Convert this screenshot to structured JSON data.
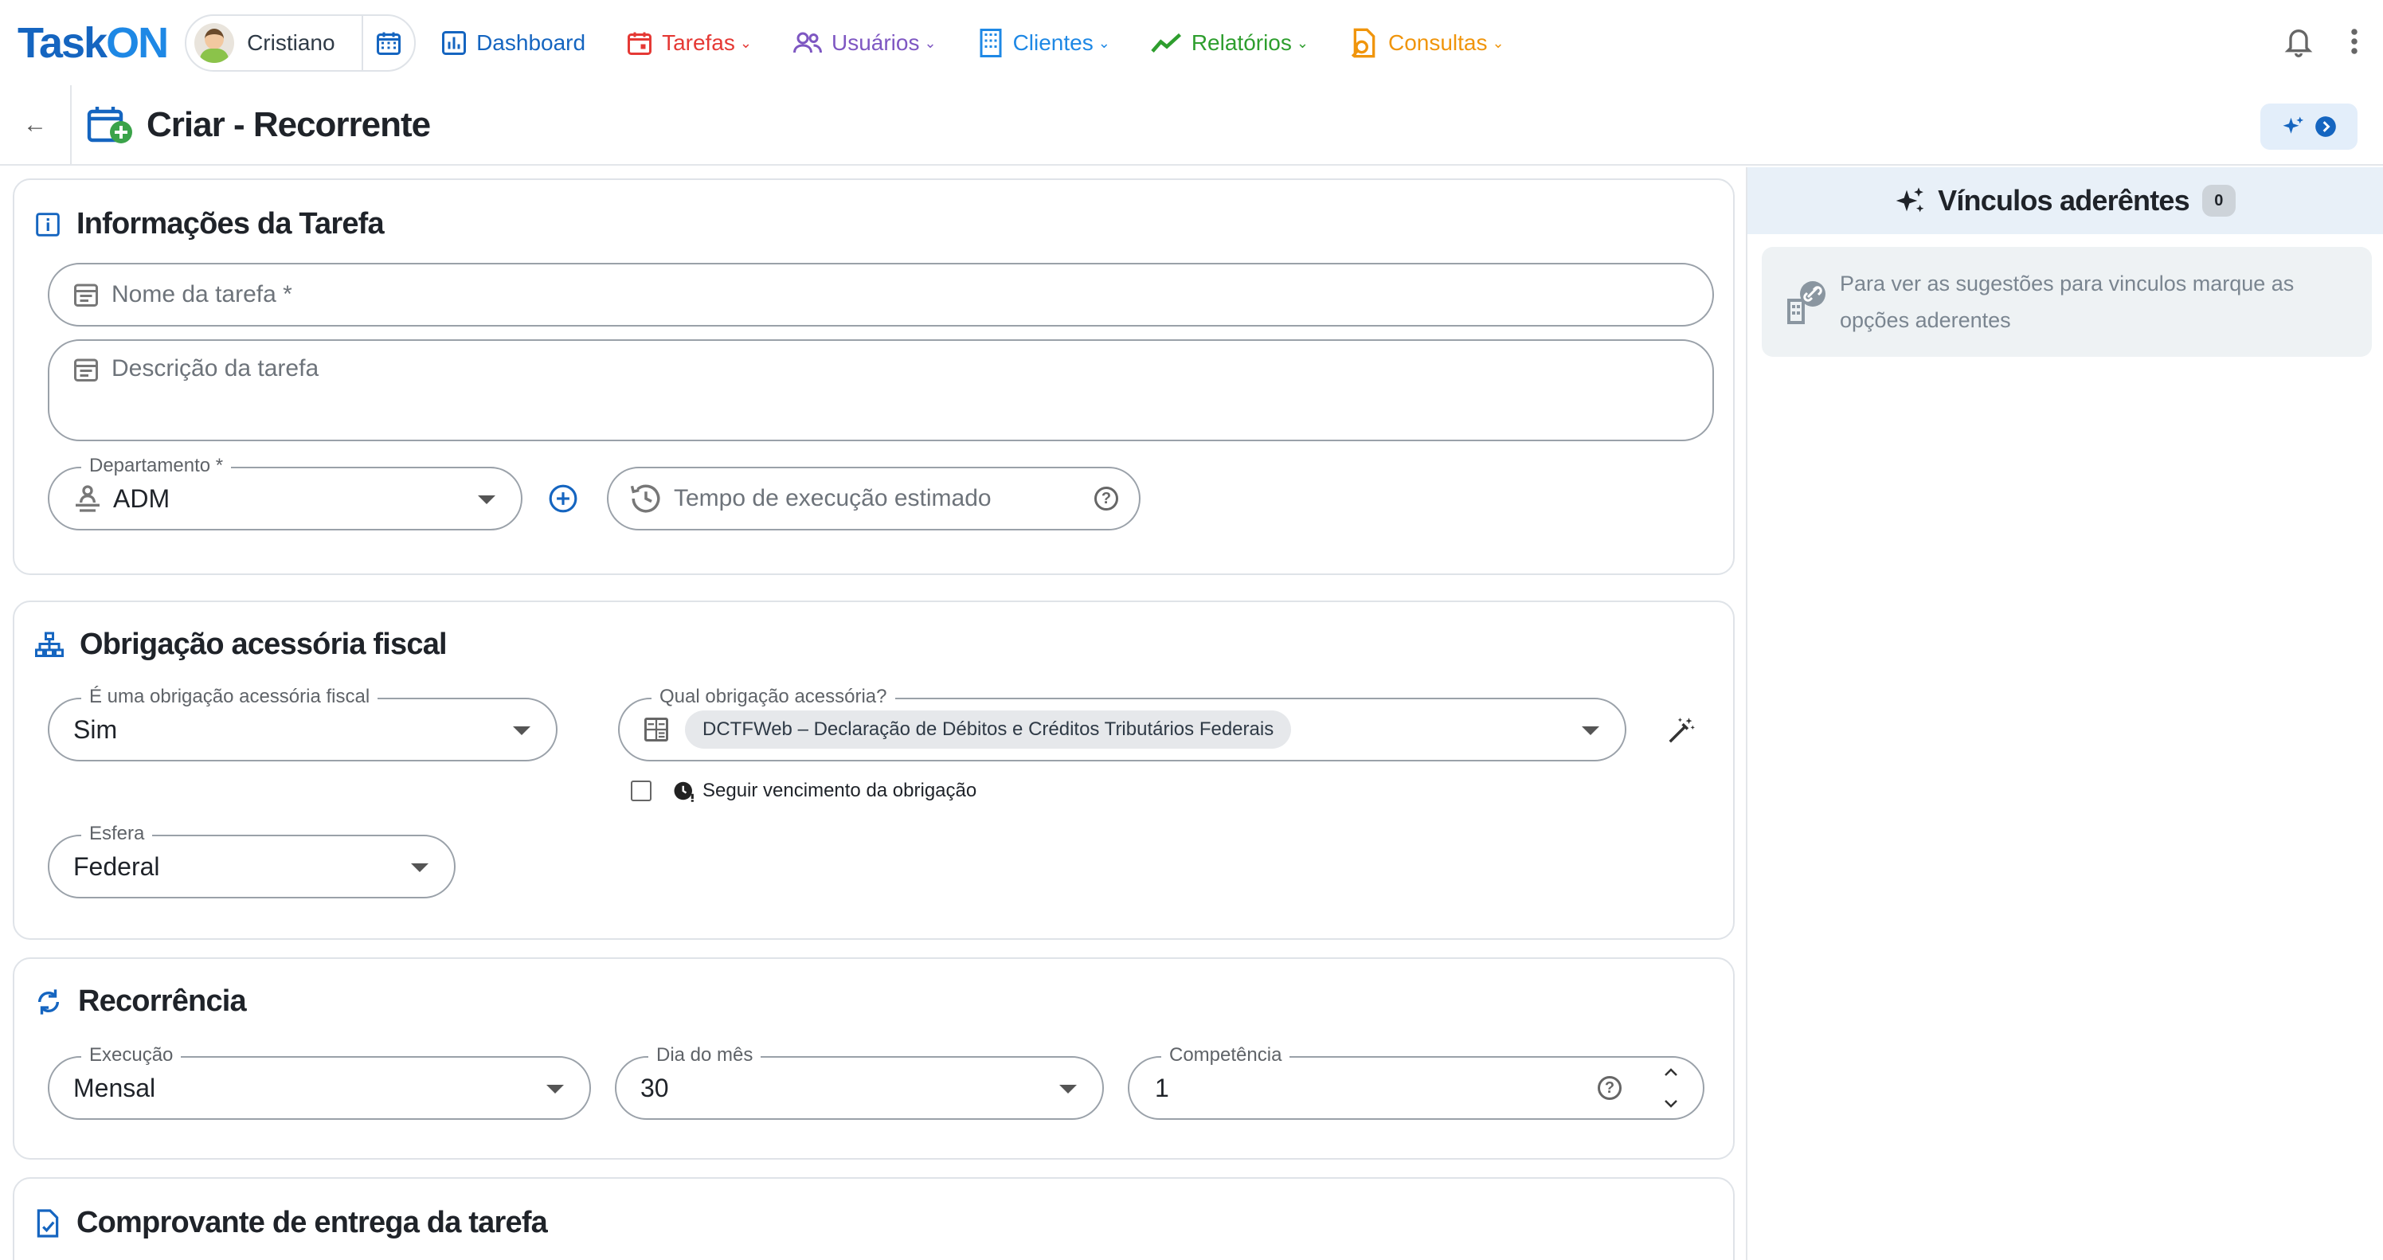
{
  "brand": {
    "logo_task": "Task",
    "logo_on": "ON"
  },
  "user": {
    "name": "Cristiano"
  },
  "nav": {
    "items": [
      {
        "label": "Dashboard",
        "color": "#1565c0",
        "has_menu": false
      },
      {
        "label": "Tarefas",
        "color": "#e53935",
        "has_menu": true
      },
      {
        "label": "Usuários",
        "color": "#7e57c2",
        "has_menu": true
      },
      {
        "label": "Clientes",
        "color": "#1e88e5",
        "has_menu": true
      },
      {
        "label": "Relatórios",
        "color": "#2e9e2e",
        "has_menu": true
      },
      {
        "label": "Consultas",
        "color": "#f0950c",
        "has_menu": true
      }
    ],
    "chevron": "⌄"
  },
  "title": {
    "back": "←",
    "text": "Criar - Recorrente"
  },
  "sections": {
    "info": {
      "title": "Informações da Tarefa",
      "task_name_placeholder": "Nome da tarefa *",
      "task_desc_placeholder": "Descrição da tarefa",
      "department": {
        "label": "Departamento *",
        "value": "ADM"
      },
      "exec_time_placeholder": "Tempo de execução estimado"
    },
    "fiscal": {
      "title": "Obrigação acessória fiscal",
      "is_fiscal": {
        "label": "É uma obrigação acessória fiscal",
        "value": "Sim"
      },
      "which": {
        "label": "Qual obrigação acessória?",
        "chip": "DCTFWeb – Declaração de Débitos e Créditos Tributários Federais"
      },
      "follow_due": {
        "label": "Seguir vencimento da obrigação",
        "checked": false
      },
      "sphere": {
        "label": "Esfera",
        "value": "Federal"
      }
    },
    "recurrence": {
      "title": "Recorrência",
      "execution": {
        "label": "Execução",
        "value": "Mensal"
      },
      "day_of_month": {
        "label": "Dia do mês",
        "value": "30"
      },
      "competence": {
        "label": "Competência",
        "value": "1"
      }
    },
    "proof": {
      "title": "Comprovante de entrega da tarefa"
    }
  },
  "side_panel": {
    "title": "Vínculos aderêntes",
    "count": "0",
    "note": "Para ver as sugestões para vinculos marque as opções aderentes"
  },
  "colors": {
    "accent": "#1565c0",
    "border": "#dfe3e8",
    "panel_header": "#e8f0f8"
  }
}
